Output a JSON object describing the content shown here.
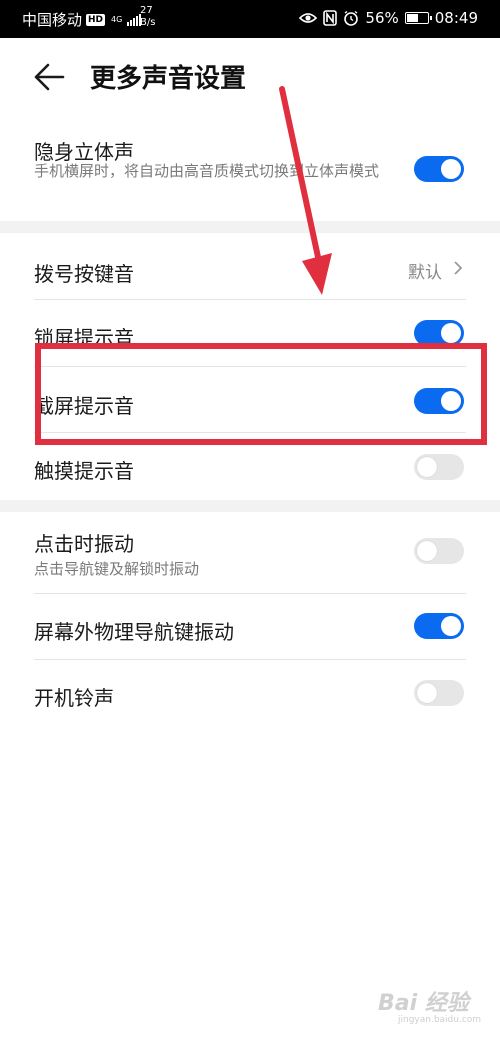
{
  "status_bar": {
    "carrier": "中国移动",
    "hd": "HD",
    "network_type": "4G",
    "speed_value": "27",
    "speed_unit": "B/s",
    "battery": "56%",
    "battery_level": 0.56,
    "time": "08:49",
    "icons": [
      "eye-icon",
      "nfc-icon",
      "alarm-icon",
      "battery-icon"
    ]
  },
  "header": {
    "title": "更多声音设置",
    "back_icon": "arrow-left-icon"
  },
  "settings": [
    {
      "title": "隐身立体声",
      "subtitle": "手机横屏时，将自动由高音质模式切换到立体声模式",
      "control": "toggle",
      "on": true
    },
    {
      "title": "拨号按键音",
      "control": "link",
      "value": "默认"
    },
    {
      "title": "锁屏提示音",
      "control": "toggle",
      "on": true
    },
    {
      "title": "截屏提示音",
      "control": "toggle",
      "on": true
    },
    {
      "title": "触摸提示音",
      "control": "toggle",
      "on": false
    },
    {
      "title": "点击时振动",
      "subtitle": "点击导航键及解锁时振动",
      "control": "toggle",
      "on": false
    },
    {
      "title": "屏幕外物理导航键振动",
      "control": "toggle",
      "on": true
    },
    {
      "title": "开机铃声",
      "control": "toggle",
      "on": false
    }
  ],
  "annotation": {
    "color": "#e03040",
    "highlighted_item": "截屏提示音"
  },
  "watermark": {
    "text": "Bai 经验",
    "sub": "jingyan.baidu.com"
  },
  "colors": {
    "toggle_on": "#0a6af0",
    "toggle_off": "#e6e6e6"
  }
}
